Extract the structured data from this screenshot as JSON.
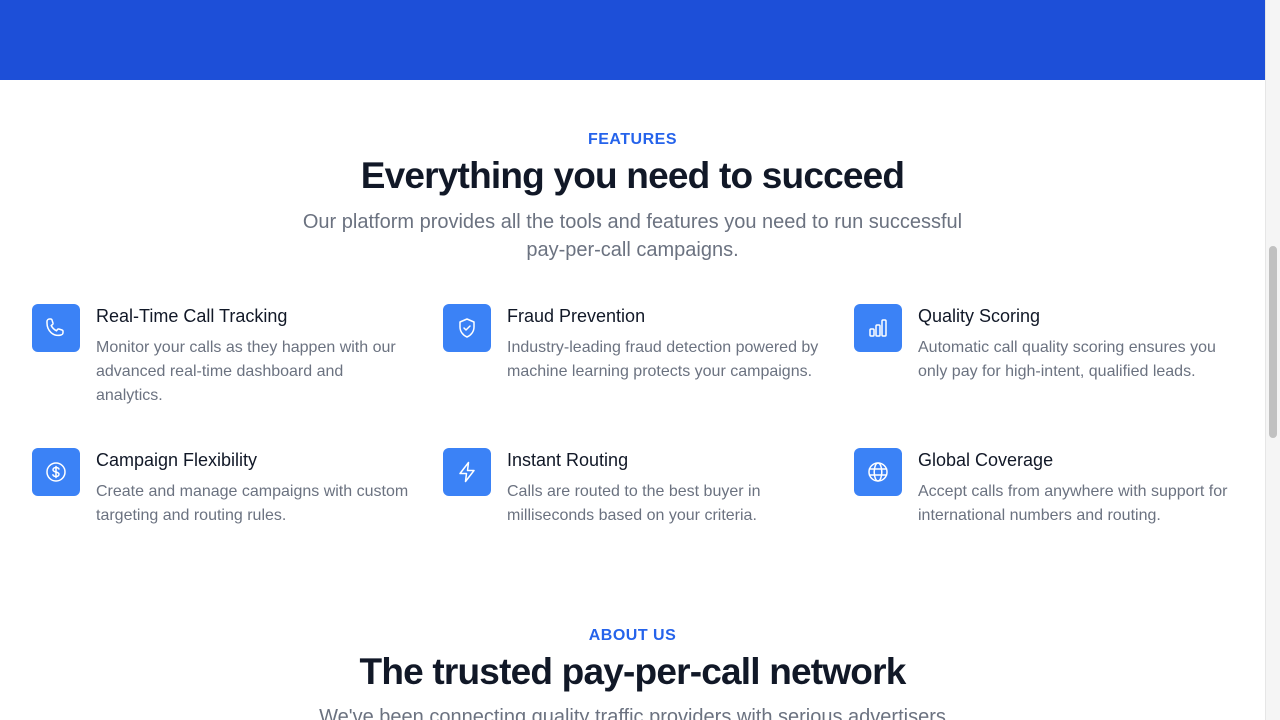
{
  "features": {
    "eyebrow": "FEATURES",
    "title": "Everything you need to succeed",
    "subtitle": "Our platform provides all the tools and features you need to run successful pay-per-call campaigns.",
    "items": [
      {
        "icon": "phone-icon",
        "title": "Real-Time Call Tracking",
        "description": "Monitor your calls as they happen with our advanced real-time dashboard and analytics."
      },
      {
        "icon": "shield-check-icon",
        "title": "Fraud Prevention",
        "description": "Industry-leading fraud detection powered by machine learning protects your campaigns."
      },
      {
        "icon": "bar-chart-icon",
        "title": "Quality Scoring",
        "description": "Automatic call quality scoring ensures you only pay for high-intent, qualified leads."
      },
      {
        "icon": "dollar-circle-icon",
        "title": "Campaign Flexibility",
        "description": "Create and manage campaigns with custom targeting and routing rules."
      },
      {
        "icon": "lightning-bolt-icon",
        "title": "Instant Routing",
        "description": "Calls are routed to the best buyer in milliseconds based on your criteria."
      },
      {
        "icon": "globe-icon",
        "title": "Global Coverage",
        "description": "Accept calls from anywhere with support for international numbers and routing."
      }
    ]
  },
  "about": {
    "eyebrow": "ABOUT US",
    "title": "The trusted pay-per-call network",
    "subtitle": "We've been connecting quality traffic providers with serious advertisers"
  },
  "colors": {
    "hero_band": "#1d4fd8",
    "accent": "#2563eb",
    "icon_bg": "#3b82f6",
    "heading": "#111827",
    "muted": "#6b7280"
  }
}
